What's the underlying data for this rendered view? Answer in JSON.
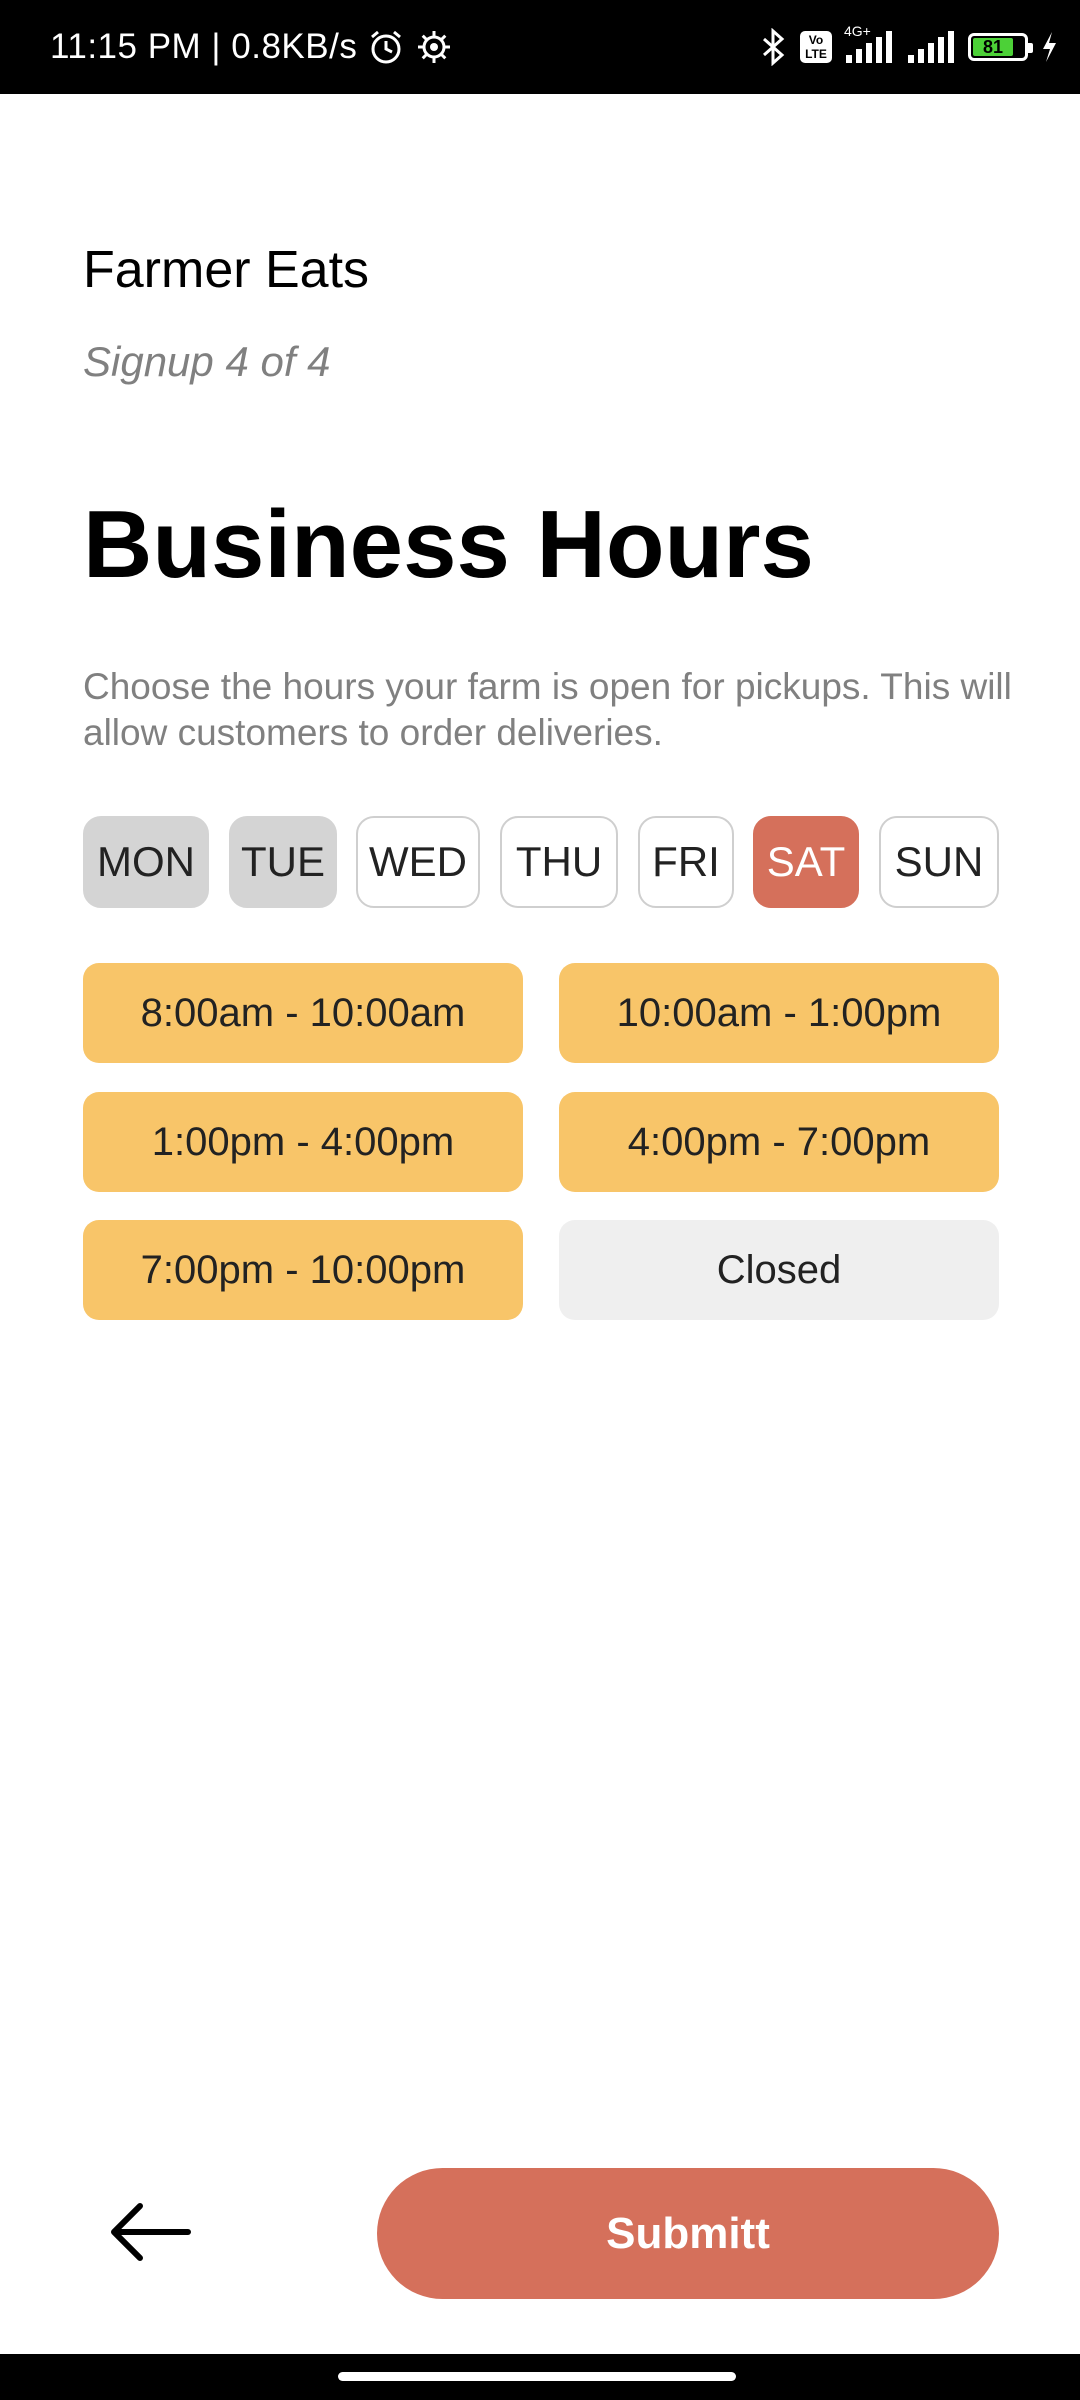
{
  "status_bar": {
    "time": "11:15 PM | 0.8KB/s",
    "network": "4G+",
    "volte": "Vo LTE",
    "battery_level": "81",
    "icons": [
      "alarm-icon",
      "settings-icon",
      "bluetooth-icon",
      "volte-icon",
      "signal-icon",
      "battery-icon",
      "charging-icon"
    ]
  },
  "header": {
    "app_name": "Farmer Eats",
    "step": "Signup 4 of 4"
  },
  "main": {
    "title": "Business Hours",
    "description": "Choose the hours your farm is open for pickups. This will allow customers to order deliveries."
  },
  "days": [
    {
      "label": "MON",
      "state": "filled"
    },
    {
      "label": "TUE",
      "state": "filled"
    },
    {
      "label": "WED",
      "state": "empty"
    },
    {
      "label": "THU",
      "state": "empty"
    },
    {
      "label": "FRI",
      "state": "empty"
    },
    {
      "label": "SAT",
      "state": "active"
    },
    {
      "label": "SUN",
      "state": "empty"
    }
  ],
  "time_slots": [
    {
      "label": "8:00am - 10:00am",
      "selected": true
    },
    {
      "label": "10:00am - 1:00pm",
      "selected": true
    },
    {
      "label": "1:00pm - 4:00pm",
      "selected": true
    },
    {
      "label": "4:00pm - 7:00pm",
      "selected": true
    },
    {
      "label": "7:00pm - 10:00pm",
      "selected": true
    },
    {
      "label": "Closed",
      "selected": false
    }
  ],
  "footer": {
    "back_icon": "arrow-left-icon",
    "submit_label": "Submitt"
  },
  "colors": {
    "accent": "#d5705b",
    "slot_selected": "#f8c569",
    "slot_unselected": "#efefef",
    "day_filled": "#d4d4d4"
  }
}
